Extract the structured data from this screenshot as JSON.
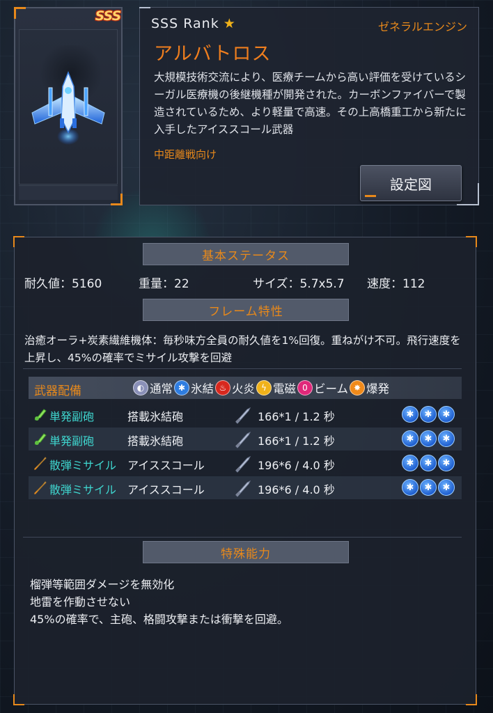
{
  "unit_card": {
    "rank_badge": "SSS"
  },
  "info": {
    "rank": "SSS  Rank",
    "manufacturer": "ゼネラルエンジン",
    "name": "アルバトロス",
    "description": "大規模技術交流により、医療チームから高い評価を受けているシーガル医療機の後継機種が開発された。カーボンファイバーで製造されているため、より軽量で高速。その上高橋重工から新たに入手したアイススコール武器",
    "role": "中距離戦向け",
    "design_button": "設定図"
  },
  "basic_status": {
    "header": "基本ステータス",
    "durability": "耐久値：5160",
    "weight": "重量：22",
    "size": "サイズ：5.7x5.7",
    "speed": "速度：112"
  },
  "frame": {
    "header": "フレーム特性",
    "text": "治癒オーラ+炭素繊維機体：毎秒味方全員の耐久値を1%回復。重ねがけ不可。飛行速度を上昇し、45%の確率でミサイル攻撃を回避"
  },
  "weapons": {
    "header": "武器配備",
    "legend": [
      {
        "label": "通常",
        "icon": "normal-icon",
        "color": "#9aa0c8",
        "glyph": "◐"
      },
      {
        "label": "氷結",
        "icon": "ice-icon",
        "color": "#2f7de0",
        "glyph": "✱"
      },
      {
        "label": "火炎",
        "icon": "fire-icon",
        "color": "#d8281e",
        "glyph": "♨"
      },
      {
        "label": "電磁",
        "icon": "electric-icon",
        "color": "#f0b21a",
        "glyph": "ϟ"
      },
      {
        "label": "ビーム",
        "icon": "beam-icon",
        "color": "#e0287a",
        "glyph": "0"
      },
      {
        "label": "爆発",
        "icon": "explosion-icon",
        "color": "#f08a1a",
        "glyph": "✸"
      }
    ],
    "rows": [
      {
        "type": "単発副砲",
        "name": "搭載氷結砲",
        "damage": "166*1 / 1.2 秒",
        "slots": 3
      },
      {
        "type": "単発副砲",
        "name": "搭載氷結砲",
        "damage": "166*1 / 1.2 秒",
        "slots": 3
      },
      {
        "type": "散弾ミサイル",
        "name": "アイススコール",
        "damage": "196*6 / 4.0 秒",
        "slots": 3
      },
      {
        "type": "散弾ミサイル",
        "name": "アイススコール",
        "damage": "196*6 / 4.0 秒",
        "slots": 3
      }
    ]
  },
  "special": {
    "header": "特殊能力",
    "lines": [
      "榴弾等範囲ダメージを無効化",
      "地雷を作動させない",
      "45%の確率で、主砲、格闘攻撃または衝撃を回避。"
    ]
  },
  "colors": {
    "accent_orange": "#e8891b",
    "weapon_type_teal": "#3fd6cf",
    "ice_blue": "#2f7de0"
  }
}
